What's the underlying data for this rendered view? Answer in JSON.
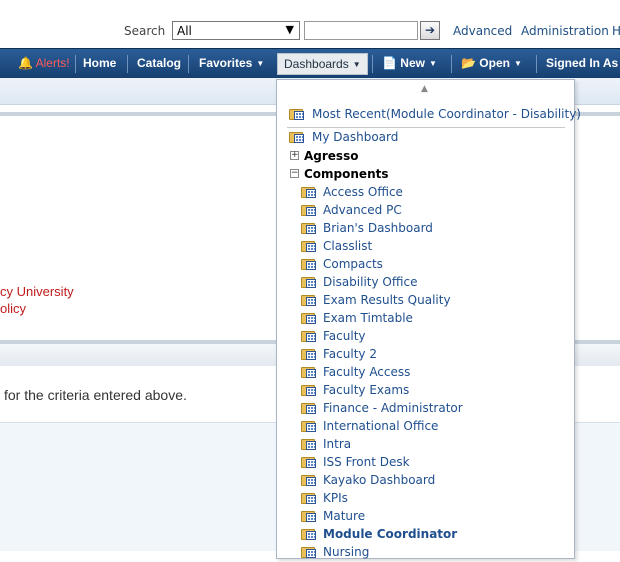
{
  "header": {
    "search_label": "Search",
    "search_scope": "All",
    "search_value": "",
    "links": [
      "Advanced",
      "Administration",
      "H"
    ]
  },
  "navbar": {
    "alerts": "Alerts!",
    "home": "Home",
    "catalog": "Catalog",
    "favorites": "Favorites",
    "dashboards": "Dashboards",
    "new": "New",
    "open": "Open",
    "signed_in": "Signed In As"
  },
  "page": {
    "red_line_1": "cy University",
    "red_line_2": "olicy",
    "message": "for the criteria entered above."
  },
  "dropdown": {
    "most_recent": "Most Recent(Module Coordinator - Disability)",
    "my_dashboard": "My Dashboard",
    "groups": [
      {
        "label": "Agresso",
        "expanded": false
      },
      {
        "label": "Components",
        "expanded": true
      }
    ],
    "components": [
      "Access Office",
      "Advanced PC",
      "Brian's Dashboard",
      "Classlist",
      "Compacts",
      "Disability Office",
      "Exam Results Quality",
      "Exam Timtable",
      "Faculty",
      "Faculty 2",
      "Faculty Access",
      "Faculty Exams",
      "Finance - Administrator",
      "International Office",
      "Intra",
      "ISS Front Desk",
      "Kayako Dashboard",
      "KPIs",
      "Mature",
      "Module Coordinator",
      "Nursing"
    ],
    "highlighted": "Module Coordinator"
  },
  "icons": {
    "alerts": "bell-icon",
    "new": "new-document-icon",
    "open": "open-folder-icon",
    "dashboard": "dashboard-folder-icon"
  }
}
